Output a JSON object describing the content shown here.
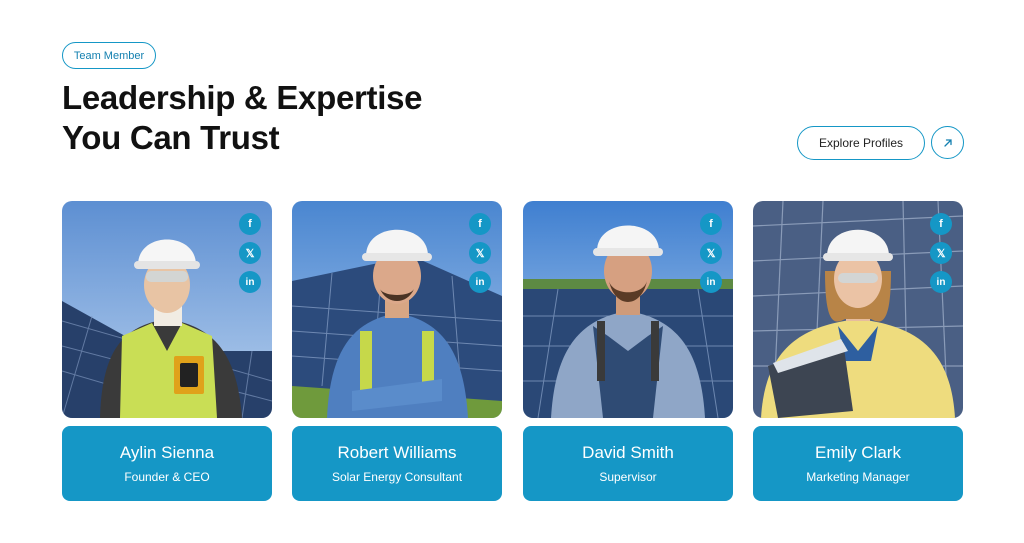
{
  "header": {
    "badge": "Team Member",
    "title_line1": "Leadership & Expertise",
    "title_line2": "You Can Trust",
    "explore_label": "Explore Profiles",
    "arrow_icon": "arrow-up-right-icon"
  },
  "colors": {
    "accent": "#1597c6",
    "heading": "#111111"
  },
  "social_icons": [
    "facebook-icon",
    "x-icon",
    "linkedin-icon"
  ],
  "team": [
    {
      "name": "Aylin Sienna",
      "role": "Founder & CEO"
    },
    {
      "name": "Robert Williams",
      "role": "Solar Energy Consultant"
    },
    {
      "name": "David Smith",
      "role": "Supervisor"
    },
    {
      "name": "Emily Clark",
      "role": "Marketing Manager"
    }
  ]
}
